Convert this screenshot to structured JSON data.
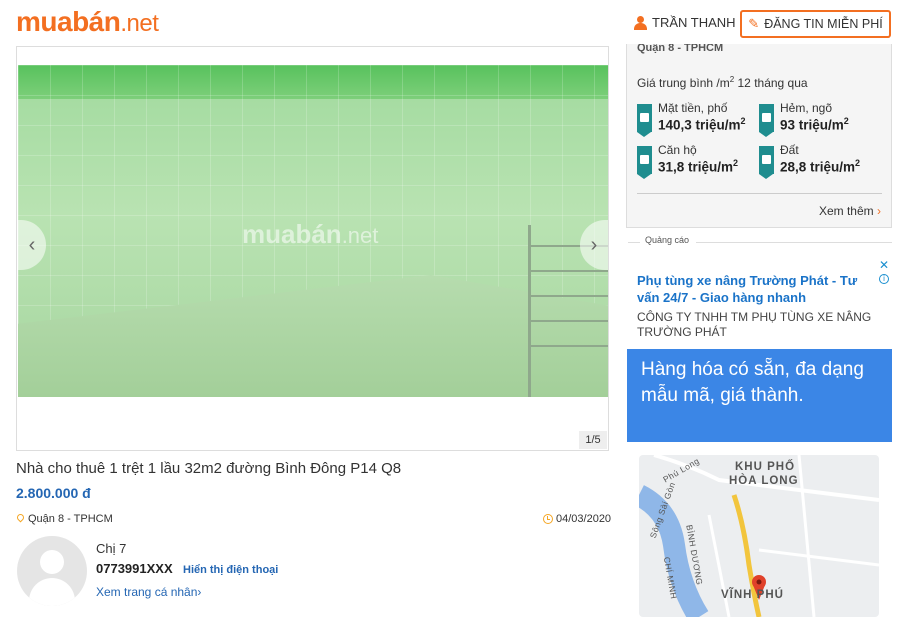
{
  "header": {
    "logo_main": "muabán",
    "logo_suffix": ".net",
    "user_name": "TRẦN THANH",
    "post_button": "ĐĂNG TIN MIỄN PHÍ"
  },
  "listing": {
    "photo_watermark_main": "muabán",
    "photo_watermark_suffix": ".net",
    "photo_counter": "1/5",
    "title": "Nhà cho thuê 1 trệt 1 lầu 32m2 đường Bình Đông P14 Q8",
    "price": "2.800.000 đ",
    "location": "Quận 8 - TPHCM",
    "date": "04/03/2020"
  },
  "seller": {
    "name": "Chị 7",
    "phone": "0773991XXX",
    "show_phone": "Hiển thị điện thoại",
    "profile_link": "Xem trang cá nhân",
    "profile_chevron": "›"
  },
  "price_stats": {
    "location": "Quận 8 - TPHCM",
    "caption_pre": "Giá trung bình /m",
    "caption_sup": "2",
    "caption_post": " 12 tháng qua",
    "items": [
      {
        "label": "Mặt tiền, phố",
        "value": "140,3 triệu/m",
        "sup": "2",
        "icon": "house-icon"
      },
      {
        "label": "Hẻm, ngõ",
        "value": "93 triệu/m",
        "sup": "2",
        "icon": "alley-house-icon"
      },
      {
        "label": "Căn hộ",
        "value": "31,8 triệu/m",
        "sup": "2",
        "icon": "apartment-icon"
      },
      {
        "label": "Đất",
        "value": "28,8 triệu/m",
        "sup": "2",
        "icon": "land-icon"
      }
    ],
    "more": "Xem thêm",
    "more_chevron": "›"
  },
  "ads": {
    "label": "Quảng cáo",
    "close": "✕",
    "info": "i",
    "headline": "Phụ tùng xe nâng Trường Phát - Tư vấn 24/7 - Giao hàng nhanh",
    "company": "CÔNG TY TNHH TM PHỤ TÙNG XE NÂNG TRƯỜNG PHÁT",
    "banner": "Hàng hóa có sẵn, đa dạng mẫu mã, giá thành.",
    "map": {
      "area_1": "KHU PHỐ",
      "area_2": "HÒA LONG",
      "area_3": "VĨNH PHÚ",
      "street_1": "Phú Long",
      "river": "Sông Sài Gòn",
      "street_2": "BÌNH DƯƠNG",
      "street_3": "CHÍ MINH"
    }
  },
  "colors": {
    "brand_orange": "#f36f21",
    "link_blue": "#2466b3",
    "stat_teal": "#1f8d8f",
    "ad_blue": "#3b86e6"
  }
}
